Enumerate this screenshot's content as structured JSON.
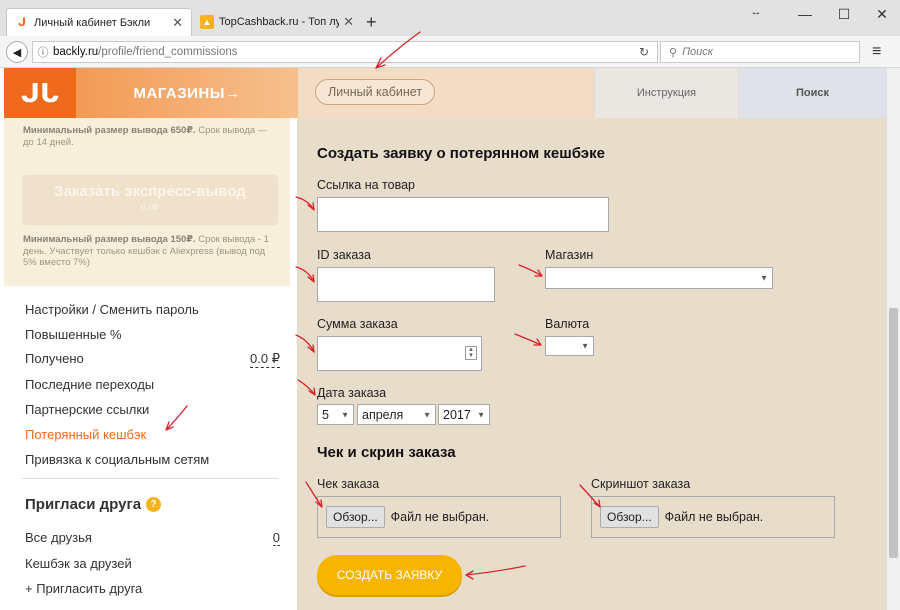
{
  "browser": {
    "tabs": [
      {
        "title": "Личный кабинет Бэкли"
      },
      {
        "title": "TopCashback.ru - Топ лу..."
      }
    ],
    "new_tab": "+",
    "window_controls": {
      "resize": "↔",
      "minimize": "—",
      "maximize": "☐",
      "close": "✕"
    },
    "url_domain": "backly.ru",
    "url_path": "/profile/friend_commissions",
    "search_placeholder": "Поиск"
  },
  "site_header": {
    "logo": "ᒍᒐ",
    "shops_label": "МАГАЗИНЫ→",
    "cabinet_label": "Личный кабинет",
    "instruction_label": "Инструкция",
    "search_label": "Поиск"
  },
  "sidebar": {
    "min_withdraw_1_bold": "Минимальный размер вывода 650₽.",
    "min_withdraw_1_rest": " Срок вывода — до 14 дней.",
    "express_label": "Заказать экспресс-вывод",
    "express_amount": "0.0₽",
    "min_withdraw_2_bold": "Минимальный размер вывода 150₽.",
    "min_withdraw_2_rest": " Срок вывода - 1 день. Участвует только кешбэк с Aliexpress (вывод под 5% вместо 7%)",
    "nav": [
      {
        "label": "Настройки / Сменить пароль"
      },
      {
        "label": "Повышенные %"
      },
      {
        "label": "Получено",
        "value": "0.0 ₽"
      },
      {
        "label": "Последние переходы"
      },
      {
        "label": "Партнерские ссылки"
      },
      {
        "label": "Потерянный кешбэк",
        "active": true
      },
      {
        "label": "Привязка к социальным сетям"
      }
    ],
    "invite_title": "Пригласи друга",
    "invite_icon": "?",
    "invite_items": [
      {
        "label": "Все друзья",
        "value": "0"
      },
      {
        "label": "Кешбэк за друзей"
      },
      {
        "label": "+ Пригласить друга"
      }
    ]
  },
  "form": {
    "title": "Создать заявку о потерянном кешбэке",
    "product_link_label": "Ссылка на товар",
    "order_id_label": "ID заказа",
    "shop_label": "Магазин",
    "order_sum_label": "Сумма заказа",
    "currency_label": "Валюта",
    "order_date_label": "Дата заказа",
    "date_day": "5",
    "date_month": "апреля",
    "date_year": "2017",
    "receipt_section_title": "Чек и скрин заказа",
    "receipt_label": "Чек заказа",
    "screenshot_label": "Скриншот заказа",
    "browse_button": "Обзор...",
    "no_file_text": "Файл не выбран.",
    "submit_label": "СОЗДАТЬ ЗАЯВКУ"
  },
  "colors": {
    "brand_orange": "#f06a1e",
    "active_link": "#f06a1e",
    "submit_yellow": "#f7b400",
    "annotation_red": "#d9232a"
  }
}
